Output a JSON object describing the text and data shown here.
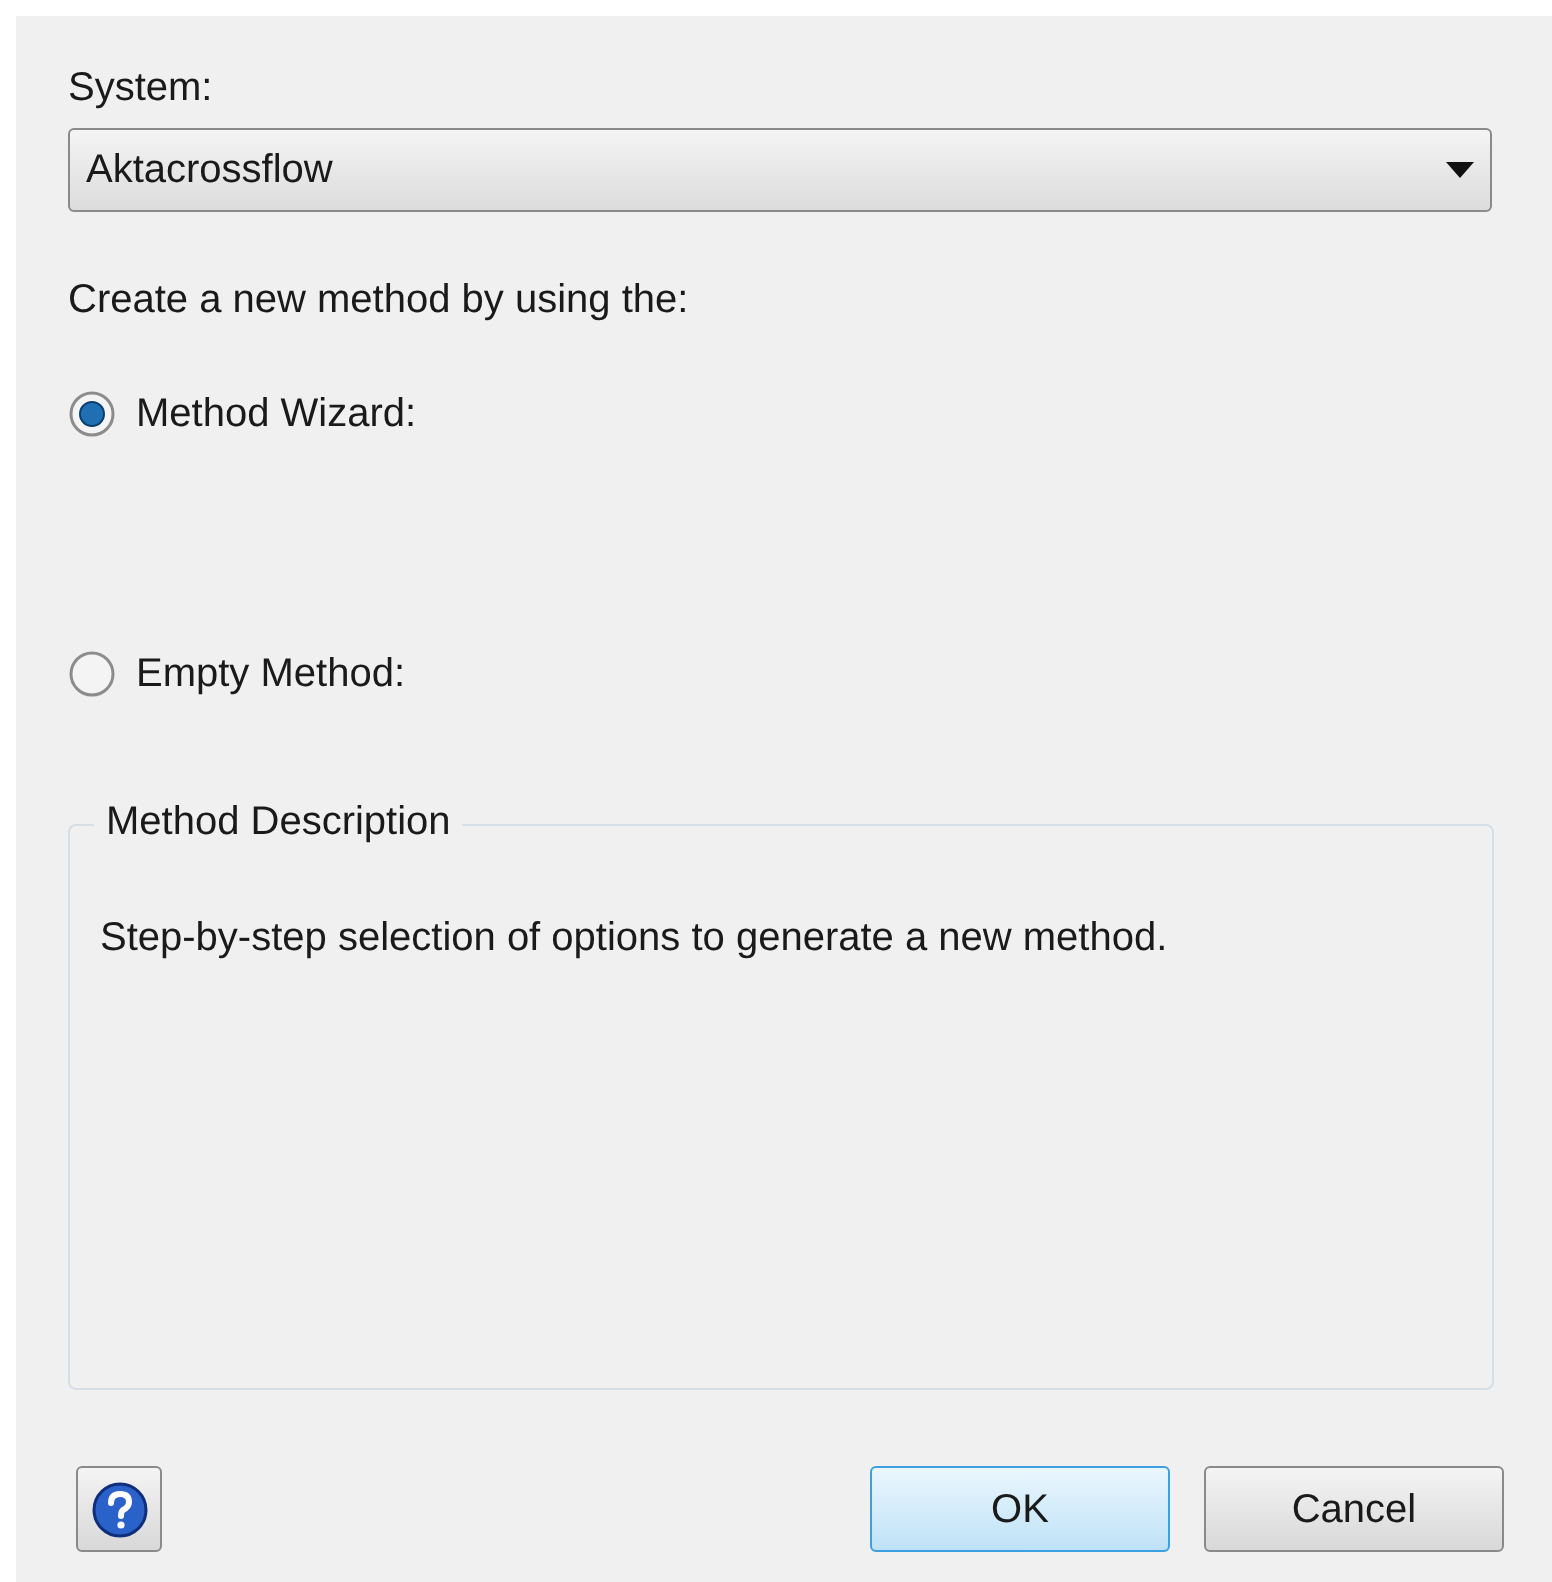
{
  "system": {
    "label": "System:",
    "value": "Aktacrossflow"
  },
  "prompt": "Create a new method by using the:",
  "options": [
    {
      "label": "Method Wizard:",
      "selected": true
    },
    {
      "label": "Empty Method:",
      "selected": false
    }
  ],
  "description": {
    "title": "Method Description",
    "text": "Step-by-step selection of options to generate a new method."
  },
  "buttons": [
    {
      "label": "OK",
      "default": true
    },
    {
      "label": "Cancel",
      "default": false
    }
  ]
}
